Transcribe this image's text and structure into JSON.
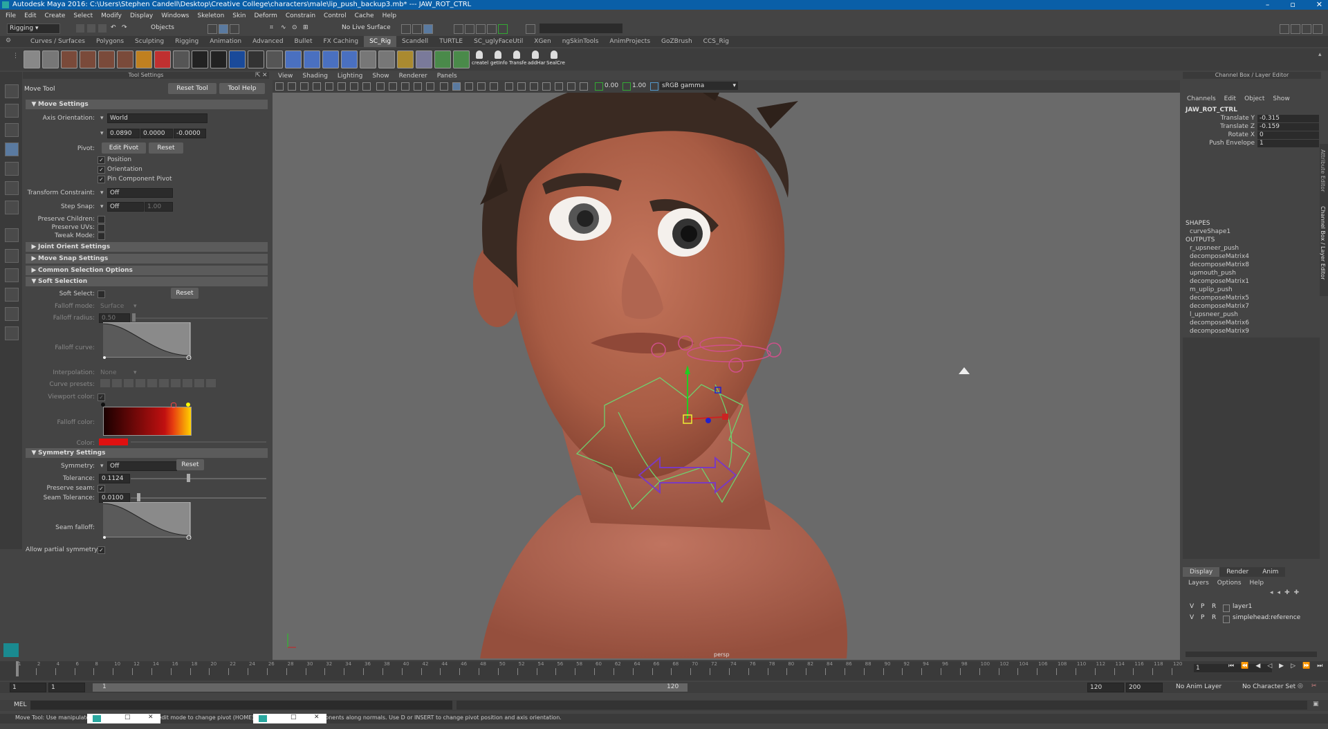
{
  "window": {
    "title": "Autodesk Maya 2016: C:\\Users\\Stephen Candell\\Desktop\\Creative College\\characters\\male\\lip_push_backup3.mb*  ---  JAW_ROT_CTRL"
  },
  "menubar": [
    "File",
    "Edit",
    "Create",
    "Select",
    "Modify",
    "Display",
    "Windows",
    "Skeleton",
    "Skin",
    "Deform",
    "Constrain",
    "Control",
    "Cache",
    "Help"
  ],
  "status_line": {
    "menu_set": "Rigging",
    "objects_label": "Objects",
    "live_surface": "No Live Surface"
  },
  "shelf_tabs": [
    "Curves / Surfaces",
    "Polygons",
    "Sculpting",
    "Rigging",
    "Animation",
    "Advanced",
    "Bullet",
    "FX Caching",
    "SC_Rig",
    "Scandell",
    "TURTLE",
    "SC_uglyFaceUtil",
    "XGen",
    "ngSkinTools",
    "AnimProjects",
    "GoZBrush",
    "CCS_Rig"
  ],
  "shelf_active": "SC_Rig",
  "shelf_buttons": [
    "createl",
    "getInfo",
    "Transfe",
    "addHar",
    "SealCre"
  ],
  "tool_settings": {
    "panel_title": "Tool Settings",
    "tool_name": "Move Tool",
    "reset_tool": "Reset Tool",
    "tool_help": "Tool Help",
    "move_settings": "Move Settings",
    "axis_orientation_label": "Axis Orientation:",
    "axis_orientation": "World",
    "axis_x": "0.0890",
    "axis_y": "0.0000",
    "axis_z": "-0.0000",
    "pivot_label": "Pivot:",
    "edit_pivot": "Edit Pivot",
    "reset": "Reset",
    "position": "Position",
    "orientation": "Orientation",
    "pin_component_pivot": "Pin Component Pivot",
    "transform_constraint_label": "Transform Constraint:",
    "transform_constraint": "Off",
    "step_snap_label": "Step Snap:",
    "step_snap": "Off",
    "step_snap_value": "1.00",
    "preserve_children": "Preserve Children:",
    "preserve_uvs": "Preserve UVs:",
    "tweak_mode": "Tweak Mode:",
    "joint_orient_settings": "Joint Orient Settings",
    "move_snap_settings": "Move Snap Settings",
    "common_selection_options": "Common Selection Options",
    "soft_selection": "Soft Selection",
    "soft_select_label": "Soft Select:",
    "falloff_mode_label": "Falloff mode:",
    "falloff_mode": "Surface",
    "falloff_radius_label": "Falloff radius:",
    "falloff_radius": "0.50",
    "falloff_curve_label": "Falloff curve:",
    "interpolation_label": "Interpolation:",
    "interpolation": "None",
    "curve_presets_label": "Curve presets:",
    "viewport_color_label": "Viewport color:",
    "falloff_color_label": "Falloff color:",
    "color_label": "Color:",
    "symmetry_settings": "Symmetry Settings",
    "symmetry_label": "Symmetry:",
    "symmetry": "Off",
    "tolerance_label": "Tolerance:",
    "tolerance": "0.1124",
    "preserve_seam_label": "Preserve seam:",
    "seam_tolerance_label": "Seam Tolerance:",
    "seam_tolerance": "0.0100",
    "seam_falloff_label": "Seam falloff:",
    "allow_partial_symmetry": "Allow partial symmetry:"
  },
  "viewport": {
    "menus": [
      "View",
      "Shading",
      "Lighting",
      "Show",
      "Renderer",
      "Panels"
    ],
    "exposure": "0.00",
    "gamma": "1.00",
    "color_space": "sRGB gamma",
    "camera_label": "persp"
  },
  "channel_box": {
    "title": "Channel Box / Layer Editor",
    "menus": [
      "Channels",
      "Edit",
      "Object",
      "Show"
    ],
    "node": "JAW_ROT_CTRL",
    "attributes": [
      {
        "name": "Translate Y",
        "value": "-0.315"
      },
      {
        "name": "Translate Z",
        "value": "-0.159"
      },
      {
        "name": "Rotate X",
        "value": "0"
      },
      {
        "name": "Push Envelope",
        "value": "1"
      }
    ],
    "shapes_label": "SHAPES",
    "shapes": [
      "curveShape1"
    ],
    "outputs_label": "OUTPUTS",
    "outputs": [
      "r_upsneer_push",
      "decomposeMatrix4",
      "decomposeMatrix8",
      "upmouth_push",
      "decomposeMatrix1",
      "m_uplip_push",
      "decomposeMatrix5",
      "decomposeMatrix7",
      "l_upsneer_push",
      "decomposeMatrix6",
      "decomposeMatrix9"
    ],
    "side_tabs": [
      "Attribute Editor",
      "Channel Box / Layer Editor"
    ]
  },
  "layer_editor": {
    "tabs": [
      "Display",
      "Render",
      "Anim"
    ],
    "menus": [
      "Layers",
      "Options",
      "Help"
    ],
    "layers": [
      {
        "v": "V",
        "p": "P",
        "r": "R",
        "name": "layer1"
      },
      {
        "v": "V",
        "p": "P",
        "r": "R",
        "name": "simplehead:reference"
      }
    ]
  },
  "timeline": {
    "ticks": [
      "1",
      "2",
      "4",
      "6",
      "8",
      "10",
      "12",
      "14",
      "16",
      "18",
      "20",
      "22",
      "24",
      "26",
      "28",
      "30",
      "32",
      "34",
      "36",
      "38",
      "40",
      "42",
      "44",
      "46",
      "48",
      "50",
      "52",
      "54",
      "56",
      "58",
      "60",
      "62",
      "64",
      "66",
      "68",
      "70",
      "72",
      "74",
      "76",
      "78",
      "80",
      "82",
      "84",
      "86",
      "88",
      "90",
      "92",
      "94",
      "96",
      "98",
      "100",
      "102",
      "104",
      "106",
      "108",
      "110",
      "112",
      "114",
      "116",
      "118",
      "120"
    ],
    "current_frame": "1"
  },
  "range": {
    "start": "1",
    "playback_start": "1",
    "slider_start": "1",
    "slider_end": "120",
    "playback_end": "120",
    "end": "200",
    "anim_layer": "No Anim Layer",
    "character_set": "No Character Set"
  },
  "command_line": {
    "label": "MEL"
  },
  "help_line": {
    "text": "Move Tool: Use manipulator to move object(s). Use edit mode to change pivot (HOME). Ctrl+LMB to move components along normals. Use D or INSERT to change pivot position and axis orientation."
  },
  "colors": {
    "title_bar": "#0a5fa8",
    "skin": "#b86a52",
    "hair": "#3a2a22",
    "falloff_gradient_start": "#1a0000",
    "falloff_gradient_mid": "#c01010",
    "falloff_gradient_end": "#ffd000",
    "color_swatch": "#e01010",
    "control_green": "#6fd06f",
    "control_purple": "#7a3ac0",
    "lip_ctrl_pink": "#d0508a"
  }
}
